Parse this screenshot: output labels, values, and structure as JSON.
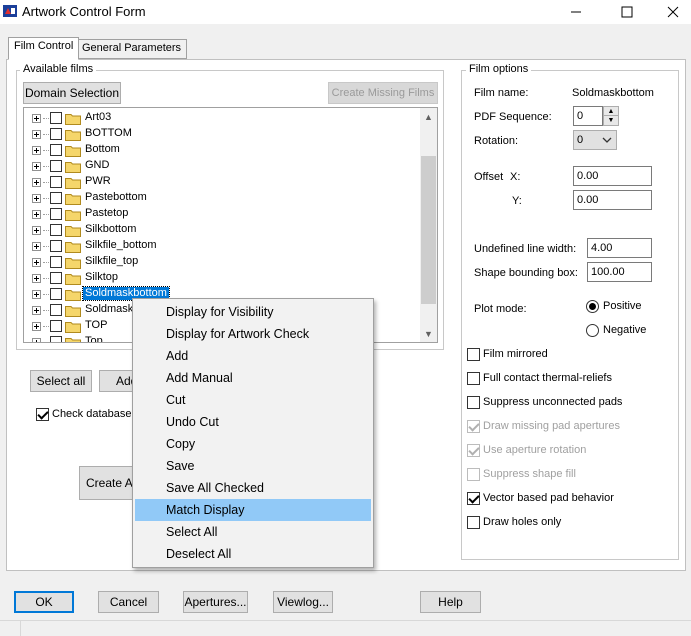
{
  "window": {
    "title": "Artwork Control Form"
  },
  "tabs": [
    {
      "label": "Film Control"
    },
    {
      "label": "General Parameters"
    }
  ],
  "available_films": {
    "label": "Available films",
    "domain_selection": "Domain Selection",
    "create_missing": "Create Missing Films",
    "items": [
      {
        "label": "Art03"
      },
      {
        "label": "BOTTOM"
      },
      {
        "label": "Bottom"
      },
      {
        "label": "GND"
      },
      {
        "label": "PWR"
      },
      {
        "label": "Pastebottom"
      },
      {
        "label": "Pastetop"
      },
      {
        "label": "Silkbottom"
      },
      {
        "label": "Silkfile_bottom"
      },
      {
        "label": "Silkfile_top"
      },
      {
        "label": "Silktop"
      },
      {
        "label": "Soldmaskbottom"
      },
      {
        "label": "Soldmask"
      },
      {
        "label": "TOP"
      },
      {
        "label": "Top"
      }
    ],
    "selected_index": 11
  },
  "left_buttons": {
    "select_all": "Select all",
    "add": "Add",
    "create_artwork": "Create Ar"
  },
  "check_database": {
    "label": "Check database",
    "checked": true
  },
  "film_options": {
    "label": "Film options",
    "film_name_label": "Film name:",
    "film_name_value": "Soldmaskbottom",
    "pdf_sequence_label": "PDF Sequence:",
    "pdf_sequence_value": "0",
    "rotation_label": "Rotation:",
    "rotation_value": "0",
    "offset_label": "Offset",
    "offset_x_label": "X:",
    "offset_x_value": "0.00",
    "offset_y_label": "Y:",
    "offset_y_value": "0.00",
    "undefined_line_width_label": "Undefined line width:",
    "undefined_line_width_value": "4.00",
    "shape_bounding_box_label": "Shape bounding box:",
    "shape_bounding_box_value": "100.00",
    "plot_mode_label": "Plot mode:",
    "plot_positive": "Positive",
    "plot_negative": "Negative",
    "checkboxes": [
      {
        "label": "Film mirrored",
        "checked": false,
        "disabled": false
      },
      {
        "label": "Full contact thermal-reliefs",
        "checked": false,
        "disabled": false
      },
      {
        "label": "Suppress unconnected pads",
        "checked": false,
        "disabled": false
      },
      {
        "label": "Draw missing pad apertures",
        "checked": true,
        "disabled": true
      },
      {
        "label": "Use aperture rotation",
        "checked": true,
        "disabled": true
      },
      {
        "label": "Suppress shape fill",
        "checked": false,
        "disabled": true
      },
      {
        "label": "Vector based pad behavior",
        "checked": true,
        "disabled": false
      },
      {
        "label": "Draw holes only",
        "checked": false,
        "disabled": false
      }
    ]
  },
  "context_menu": {
    "items": [
      {
        "label": "Display for Visibility"
      },
      {
        "label": "Display for Artwork Check"
      },
      {
        "label": "Add"
      },
      {
        "label": "Add Manual"
      },
      {
        "label": "Cut"
      },
      {
        "label": "Undo Cut"
      },
      {
        "label": "Copy"
      },
      {
        "label": "Save"
      },
      {
        "label": "Save All Checked"
      },
      {
        "label": "Match Display"
      },
      {
        "label": "Select All"
      },
      {
        "label": "Deselect All"
      }
    ],
    "highlighted_index": 9
  },
  "bottom_buttons": {
    "ok": "OK",
    "cancel": "Cancel",
    "apertures": "Apertures...",
    "viewlog": "Viewlog...",
    "help": "Help"
  },
  "colors": {
    "selection": "#0078d7",
    "menu_highlight": "#91c9f7",
    "folder": "#f5d66b"
  }
}
